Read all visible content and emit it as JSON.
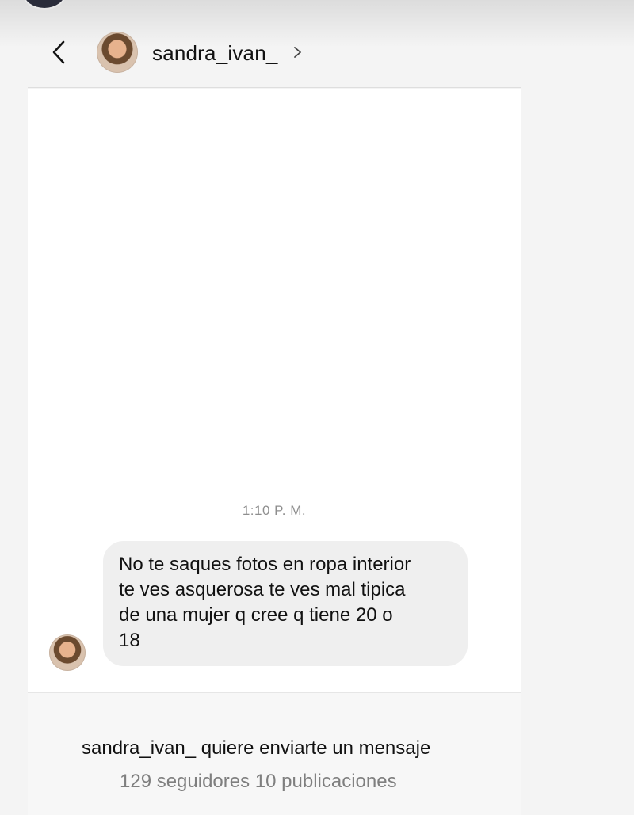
{
  "header": {
    "username": "sandra_ivan_",
    "back_icon": "chevron-left-icon",
    "profile_icon": "chevron-right-icon"
  },
  "conversation": {
    "timestamp": "1:10 P. M.",
    "message_lines": [
      "No te saques fotos en ropa interior",
      "te ves asquerosa te ves mal tipica",
      "de una mujer q cree q tiene 20 o",
      "18"
    ]
  },
  "request": {
    "username": "sandra_ivan_",
    "text": "quiere enviarte un mensaje",
    "stats": "129 seguidores 10 publicaciones"
  },
  "colors": {
    "bubble": "#efefef",
    "secondary_text": "#8e8e8e"
  }
}
